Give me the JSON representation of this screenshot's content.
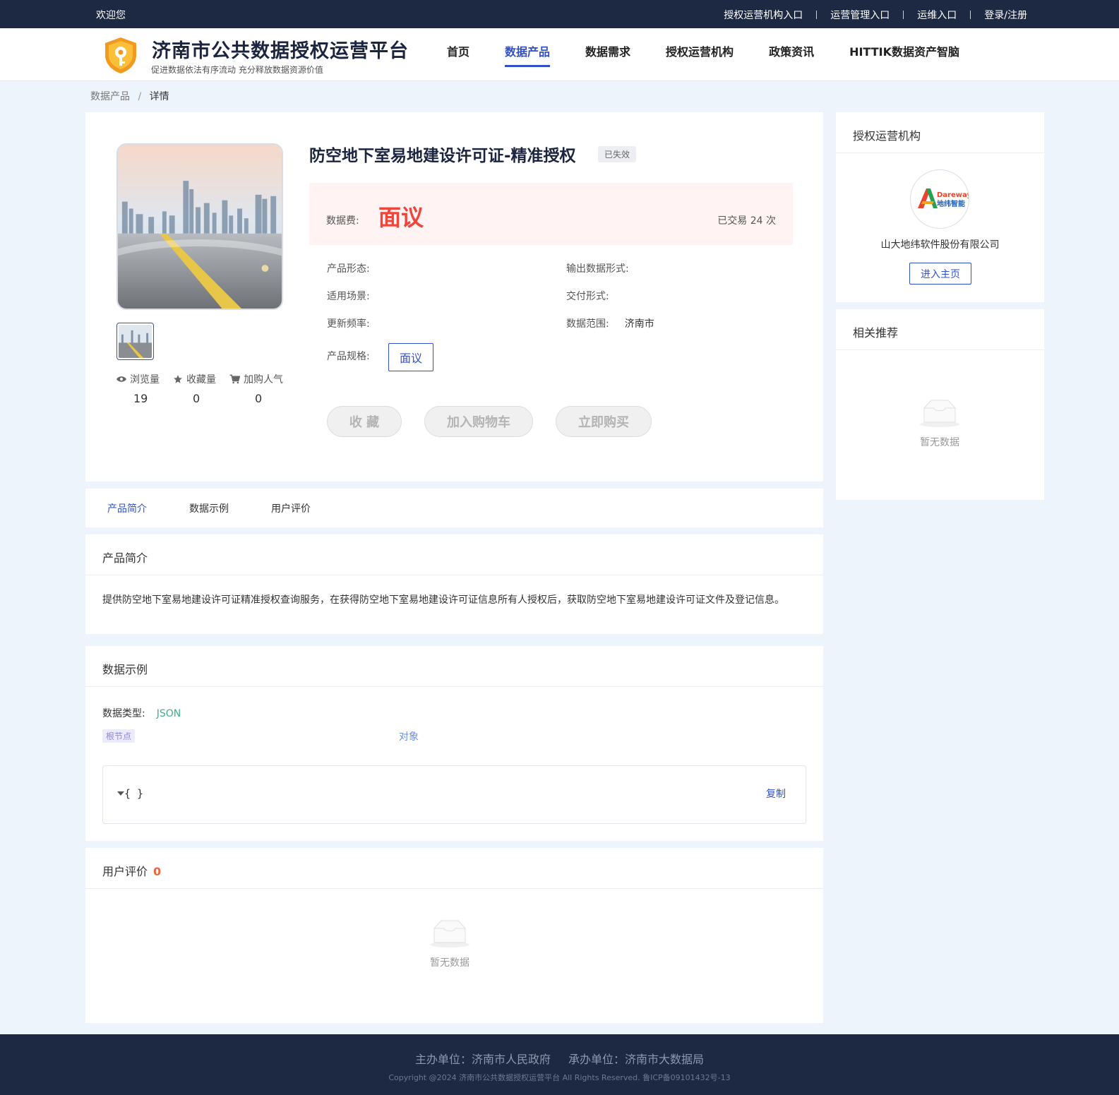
{
  "topbar": {
    "welcome": "欢迎您",
    "links": [
      "授权运营机构入口",
      "运营管理入口",
      "运维入口",
      "登录/注册"
    ]
  },
  "header": {
    "title": "济南市公共数据授权运营平台",
    "subtitle": "促进数据依法有序流动 充分释放数据资源价值",
    "nav": [
      "首页",
      "数据产品",
      "数据需求",
      "授权运营机构",
      "政策资讯",
      "HITTIK数据资产智脑"
    ],
    "active_nav": "数据产品"
  },
  "breadcrumb": {
    "parent": "数据产品",
    "separator": "/",
    "current": "详情"
  },
  "product": {
    "title": "防空地下室易地建设许可证-精准授权",
    "status": "已失效",
    "price_label": "数据费:",
    "price_value": "面议",
    "traded": "已交易 24 次",
    "attributes": {
      "form_label": "产品形态:",
      "form_value": "",
      "output_label": "输出数据形式:",
      "output_value": "",
      "scene_label": "适用场景:",
      "scene_value": "",
      "delivery_label": "交付形式:",
      "delivery_value": "",
      "frequency_label": "更新频率:",
      "frequency_value": "",
      "range_label": "数据范围:",
      "range_value": "济南市",
      "spec_label": "产品规格:",
      "spec_value": "面议"
    },
    "stats": [
      {
        "label": "浏览量",
        "icon": "eye-icon",
        "value": "19"
      },
      {
        "label": "收藏量",
        "icon": "star-icon",
        "value": "0"
      },
      {
        "label": "加购人气",
        "icon": "cart-icon",
        "value": "0"
      }
    ],
    "actions": {
      "favorite": "收 藏",
      "add_cart": "加入购物车",
      "buy": "立即购买"
    }
  },
  "sidebar": {
    "org_title": "授权运营机构",
    "org_logo_text": "Dareway",
    "org_logo_cn": "地纬智能",
    "org_name": "山大地纬软件股份有限公司",
    "org_button": "进入主页",
    "related_title": "相关推荐",
    "related_empty": "暂无数据"
  },
  "tabs": [
    "产品简介",
    "数据示例",
    "用户评价"
  ],
  "intro": {
    "title": "产品简介",
    "text": "提供防空地下室易地建设许可证精准授权查询服务，在获得防空地下室易地建设许可证信息所有人授权后，获取防空地下室易地建设许可证文件及登记信息。"
  },
  "sample": {
    "title": "数据示例",
    "type_label": "数据类型:",
    "type_value": "JSON",
    "node_tag": "根节点",
    "node_type": "对象",
    "code": "{ }",
    "copy": "复制"
  },
  "reviews": {
    "title": "用户评价",
    "count": "0",
    "empty": "暂无数据"
  },
  "footer": {
    "host": "主办单位：济南市人民政府",
    "undertaker": "承办单位：济南市大数据局",
    "copyright": "Copyright @2024 济南市公共数据授权运营平台 All Rights Reserved. 鲁ICP备09101432号-13"
  },
  "colors": {
    "accent": "#3251c8",
    "price": "#f0453a",
    "topbar": "#1d2843",
    "json_type": "#3bb386"
  }
}
